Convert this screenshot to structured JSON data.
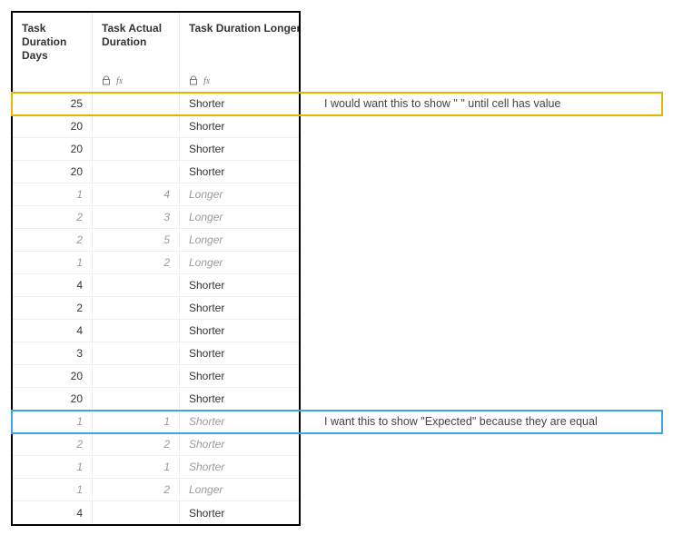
{
  "columns": {
    "c1": "Task Duration Days",
    "c2": "Task Actual Duration",
    "c3": "Task Duration Longer or Shorter"
  },
  "rows": [
    {
      "child": false,
      "c1": "25",
      "c2": "",
      "c3": "Shorter"
    },
    {
      "child": false,
      "c1": "20",
      "c2": "",
      "c3": "Shorter"
    },
    {
      "child": false,
      "c1": "20",
      "c2": "",
      "c3": "Shorter"
    },
    {
      "child": false,
      "c1": "20",
      "c2": "",
      "c3": "Shorter"
    },
    {
      "child": true,
      "c1": "1",
      "c2": "4",
      "c3": "Longer"
    },
    {
      "child": true,
      "c1": "2",
      "c2": "3",
      "c3": "Longer"
    },
    {
      "child": true,
      "c1": "2",
      "c2": "5",
      "c3": "Longer"
    },
    {
      "child": true,
      "c1": "1",
      "c2": "2",
      "c3": "Longer"
    },
    {
      "child": false,
      "c1": "4",
      "c2": "",
      "c3": "Shorter"
    },
    {
      "child": false,
      "c1": "2",
      "c2": "",
      "c3": "Shorter"
    },
    {
      "child": false,
      "c1": "4",
      "c2": "",
      "c3": "Shorter"
    },
    {
      "child": false,
      "c1": "3",
      "c2": "",
      "c3": "Shorter"
    },
    {
      "child": false,
      "c1": "20",
      "c2": "",
      "c3": "Shorter"
    },
    {
      "child": false,
      "c1": "20",
      "c2": "",
      "c3": "Shorter"
    },
    {
      "child": true,
      "c1": "1",
      "c2": "1",
      "c3": "Shorter"
    },
    {
      "child": true,
      "c1": "2",
      "c2": "2",
      "c3": "Shorter"
    },
    {
      "child": true,
      "c1": "1",
      "c2": "1",
      "c3": "Shorter"
    },
    {
      "child": true,
      "c1": "1",
      "c2": "2",
      "c3": "Longer"
    },
    {
      "child": false,
      "c1": "4",
      "c2": "",
      "c3": "Shorter"
    }
  ],
  "annotations": {
    "yellow_text": "I would want this to show \" \" until cell has value",
    "blue_text": "I want this to show \"Expected\" because they are equal"
  },
  "colors": {
    "yellow": "#e7b400",
    "blue": "#3aa6e6"
  }
}
